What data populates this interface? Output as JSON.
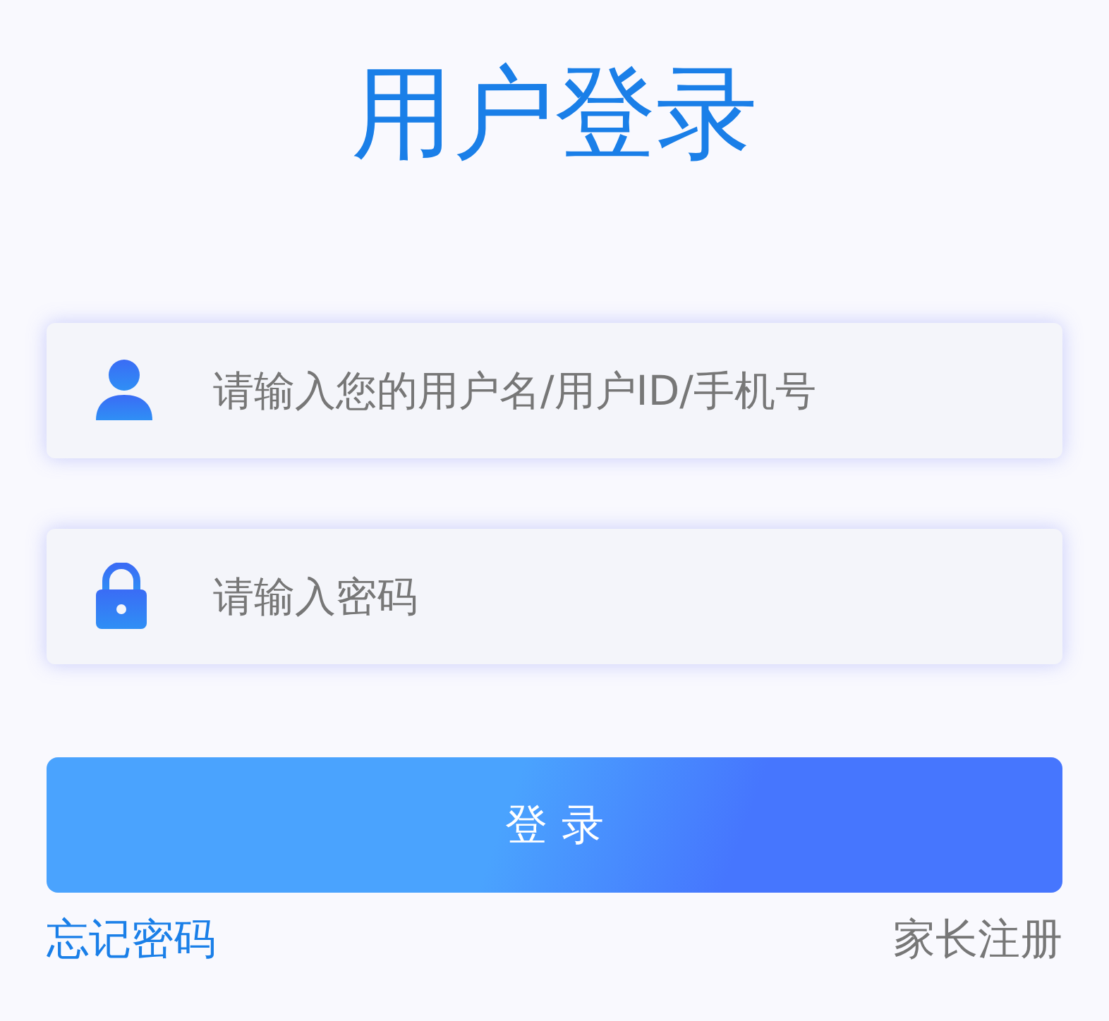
{
  "title": "用户登录",
  "fields": [
    {
      "kind": "user",
      "placeholder": "请输入您的用户名/用户ID/手机号"
    },
    {
      "kind": "password",
      "placeholder": "请输入密码"
    }
  ],
  "login_button": "登 录",
  "links": [
    {
      "kind": "forgot",
      "label": "忘记密码"
    },
    {
      "kind": "register",
      "label": "家长注册"
    }
  ]
}
